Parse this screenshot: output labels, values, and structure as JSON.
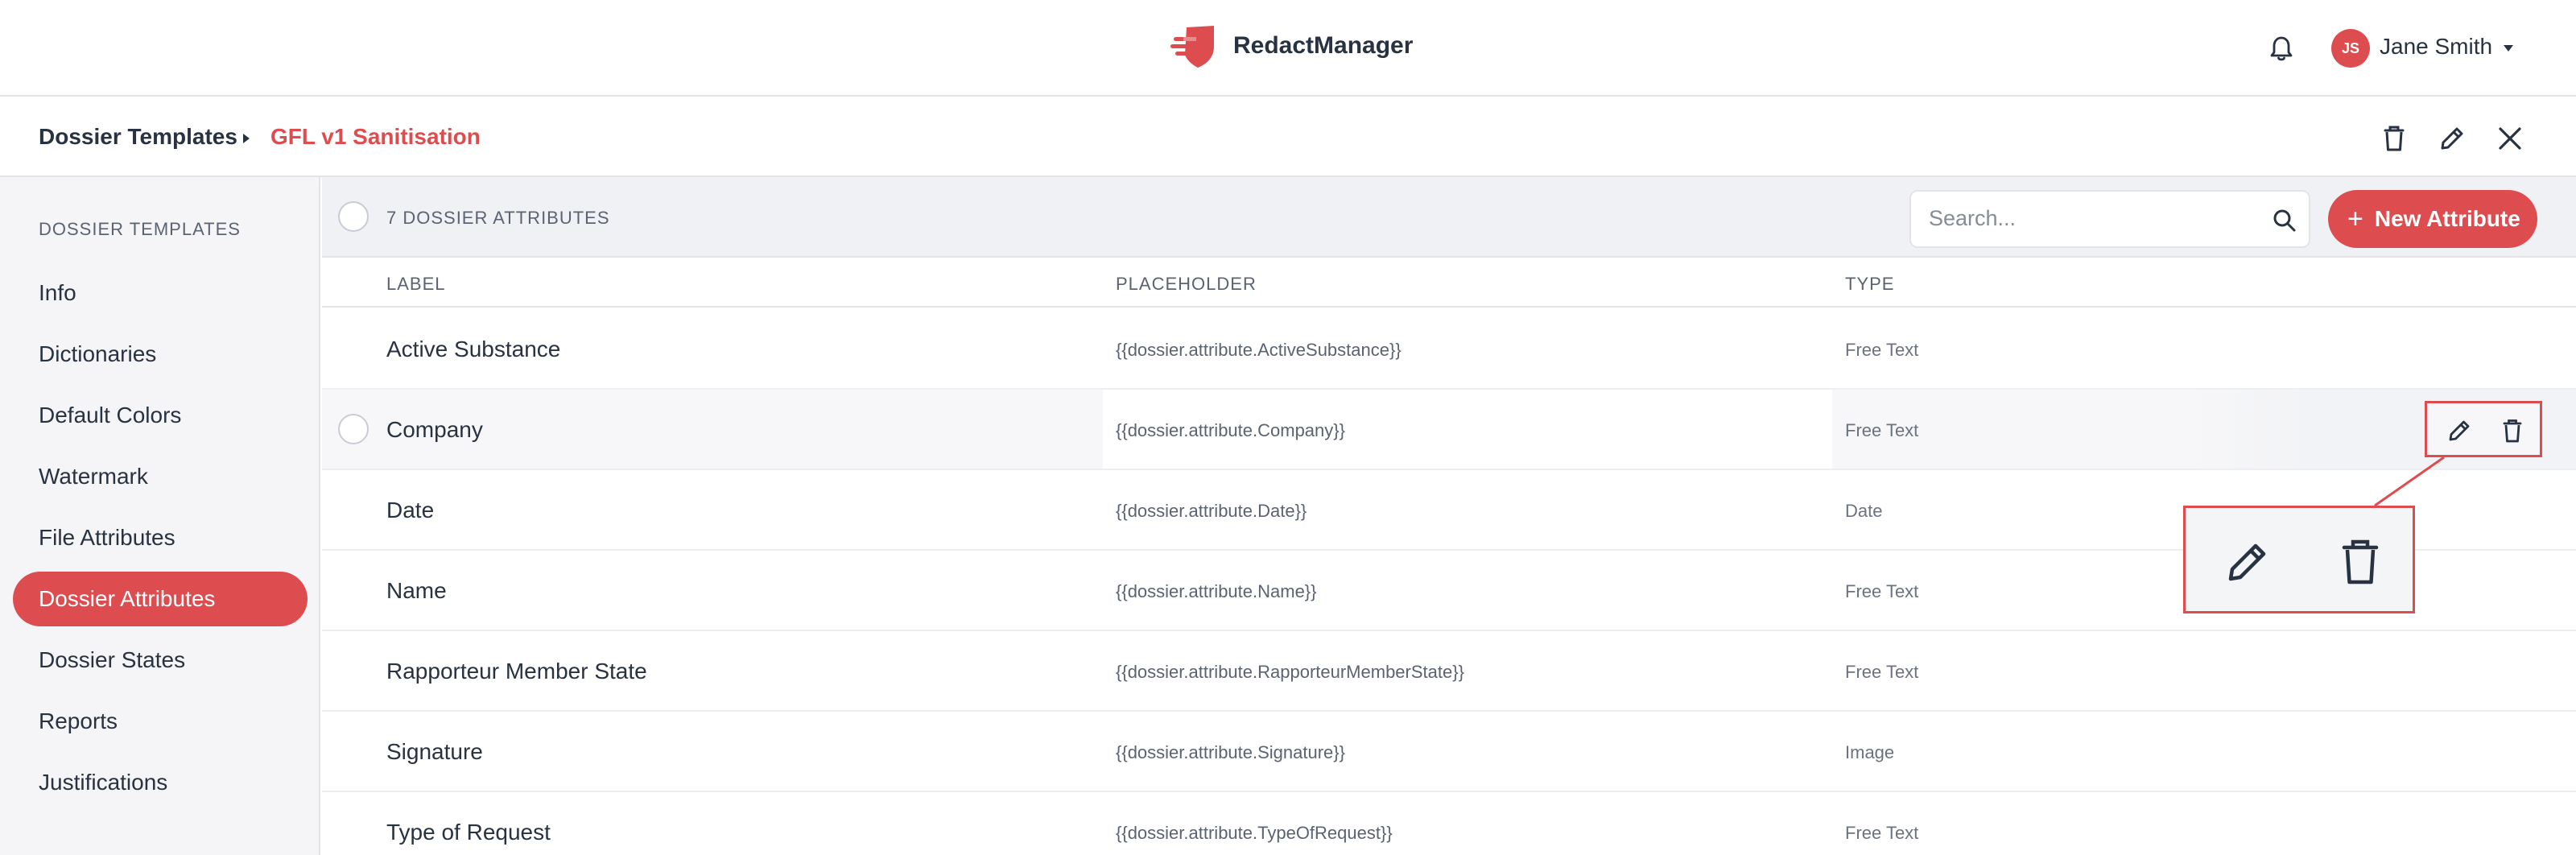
{
  "header": {
    "app_name": "RedactManager",
    "user": {
      "initials": "JS",
      "name": "Jane Smith"
    },
    "icons": {
      "logo": "shield-logo",
      "notifications": "bell-icon",
      "menu": "caret-down-icon"
    }
  },
  "breadcrumb": {
    "root": "Dossier Templates",
    "current": "GFL v1 Sanitisation",
    "actions": [
      "trash-icon",
      "pencil-icon",
      "close-icon"
    ]
  },
  "sidebar": {
    "heading": "DOSSIER TEMPLATES",
    "items": [
      {
        "label": "Info",
        "active": false
      },
      {
        "label": "Dictionaries",
        "active": false
      },
      {
        "label": "Default Colors",
        "active": false
      },
      {
        "label": "Watermark",
        "active": false
      },
      {
        "label": "File Attributes",
        "active": false
      },
      {
        "label": "Dossier Attributes",
        "active": true
      },
      {
        "label": "Dossier States",
        "active": false
      },
      {
        "label": "Reports",
        "active": false
      },
      {
        "label": "Justifications",
        "active": false
      }
    ]
  },
  "list": {
    "count_label": "7 DOSSIER ATTRIBUTES",
    "search_placeholder": "Search...",
    "new_button_label": "New Attribute",
    "columns": {
      "label": "LABEL",
      "placeholder": "PLACEHOLDER",
      "type": "TYPE"
    },
    "rows": [
      {
        "label": "Active Substance",
        "placeholder": "{{dossier.attribute.ActiveSubstance}}",
        "type": "Free Text"
      },
      {
        "label": "Company",
        "placeholder": "{{dossier.attribute.Company}}",
        "type": "Free Text"
      },
      {
        "label": "Date",
        "placeholder": "{{dossier.attribute.Date}}",
        "type": "Date"
      },
      {
        "label": "Name",
        "placeholder": "{{dossier.attribute.Name}}",
        "type": "Free Text"
      },
      {
        "label": "Rapporteur Member State",
        "placeholder": "{{dossier.attribute.RapporteurMemberState}}",
        "type": "Free Text"
      },
      {
        "label": "Signature",
        "placeholder": "{{dossier.attribute.Signature}}",
        "type": "Image"
      },
      {
        "label": "Type of Request",
        "placeholder": "{{dossier.attribute.TypeOfRequest}}",
        "type": "Free Text"
      }
    ],
    "hovered_row_actions": [
      "pencil-icon",
      "trash-icon"
    ]
  },
  "colors": {
    "accent": "#dd4d50",
    "text": "#283241",
    "muted": "#5b6372",
    "sidebar_bg": "#f5f5f7",
    "header_bg": "#f0f1f4"
  }
}
